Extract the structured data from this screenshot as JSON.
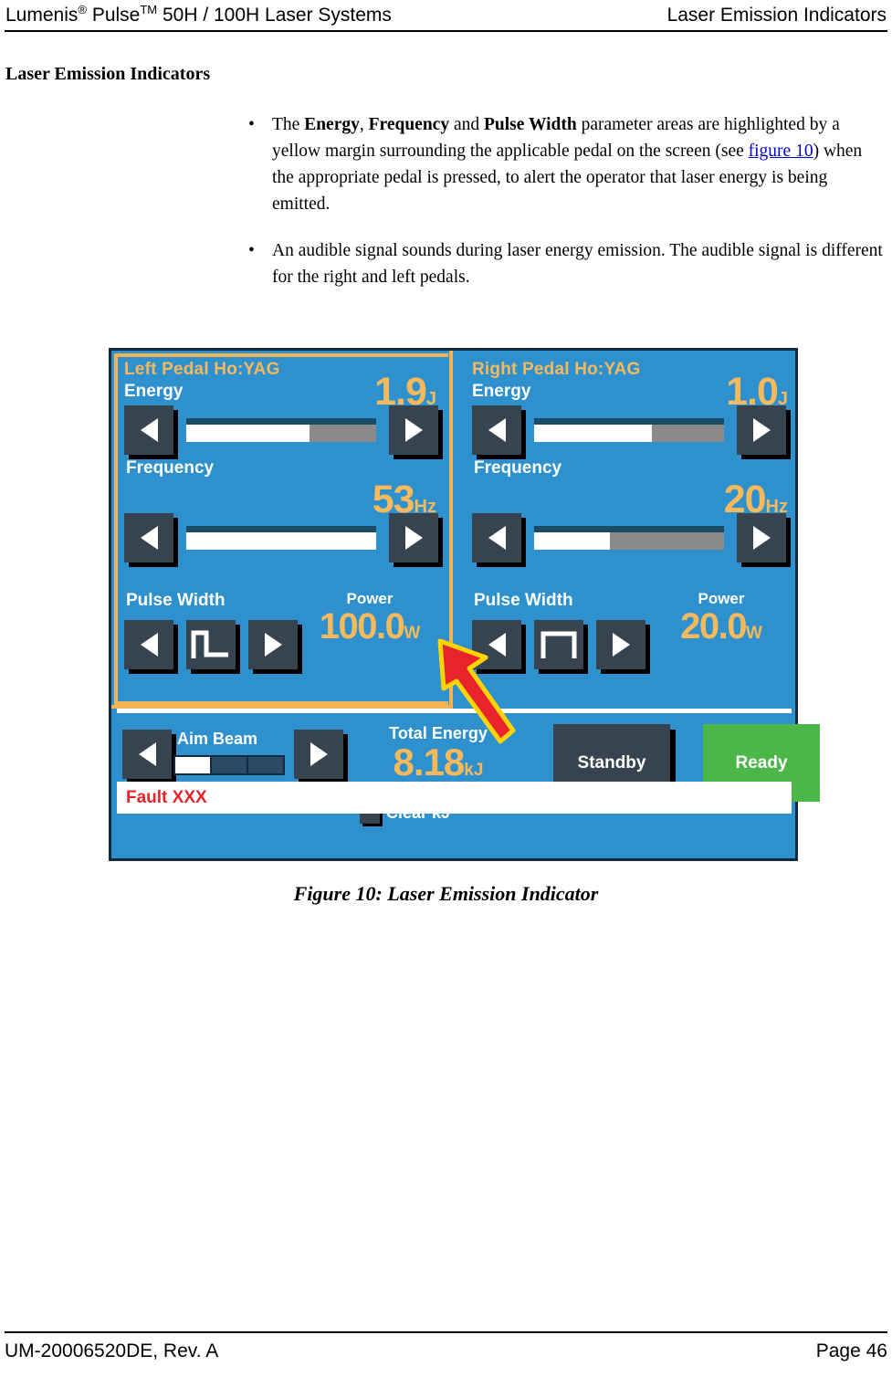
{
  "header": {
    "left_brand": "Lumenis",
    "left_reg": "®",
    "left_product": " Pulse",
    "left_tm": "TM",
    "left_rest": " 50H / 100H Laser Systems",
    "right": "Laser Emission Indicators"
  },
  "section": {
    "heading": "Laser Emission Indicators"
  },
  "bullets": [
    {
      "dot": "•",
      "pre": "The ",
      "b1": "Energy",
      "mid1": ", ",
      "b2": "Frequency",
      "mid2": " and ",
      "b3": "Pulse Width",
      "mid3": " parameter areas are highlighted by a yellow margin surrounding the applicable pedal on the screen (see ",
      "link": "figure 10",
      "post": ") when the appropriate pedal is pressed, to alert the operator that laser energy is being emitted."
    },
    {
      "dot": "•",
      "text": "An audible signal sounds during laser energy emission. The audible signal is different for the right and left pedals."
    }
  ],
  "screen": {
    "colors": {
      "panel_blue": "#2e90cd",
      "highlight_yellow": "#f2b457",
      "readout_orange": "#f6b95c",
      "button_slate": "#37444f",
      "ready_green": "#4cb748",
      "fault_red": "#e8232a",
      "border_navy": "#13293d"
    },
    "left_pedal": {
      "title": "Left Pedal Ho:YAG",
      "highlighted": true,
      "energy": {
        "label": "Energy",
        "value": "1.9",
        "unit": "J",
        "slider_percent": 65
      },
      "frequency": {
        "label": "Frequency",
        "value": "53",
        "unit": "Hz",
        "slider_percent": 100
      },
      "pulse_width": {
        "label": "Pulse Width",
        "waveform": "narrow-pulse"
      },
      "power": {
        "label": "Power",
        "value": "100.0",
        "unit": "W"
      },
      "arrow_left": "◀",
      "arrow_right": "▶"
    },
    "right_pedal": {
      "title": "Right Pedal Ho:YAG",
      "highlighted": false,
      "energy": {
        "label": "Energy",
        "value": "1.0",
        "unit": "J",
        "slider_percent": 62
      },
      "frequency": {
        "label": "Frequency",
        "value": "20",
        "unit": "Hz",
        "slider_percent": 40
      },
      "pulse_width": {
        "label": "Pulse Width",
        "waveform": "wide-pulse"
      },
      "power": {
        "label": "Power",
        "value": "20.0",
        "unit": "W"
      },
      "arrow_left": "◀",
      "arrow_right": "▶"
    },
    "bottom": {
      "aim_beam": {
        "label": "Aim Beam",
        "segments": 3,
        "active_segments": 1
      },
      "total_energy": {
        "label": "Total Energy",
        "value": "8.18",
        "unit": "kJ"
      },
      "clear_kj": {
        "label": "Clear kJ",
        "checked": false
      },
      "standby_label": "Standby",
      "ready_label": "Ready",
      "fault_text": "Fault XXX"
    }
  },
  "figure": {
    "caption": "Figure 10: Laser Emission Indicator"
  },
  "footer": {
    "left": "UM-20006520DE, Rev. A",
    "right": "Page 46"
  }
}
